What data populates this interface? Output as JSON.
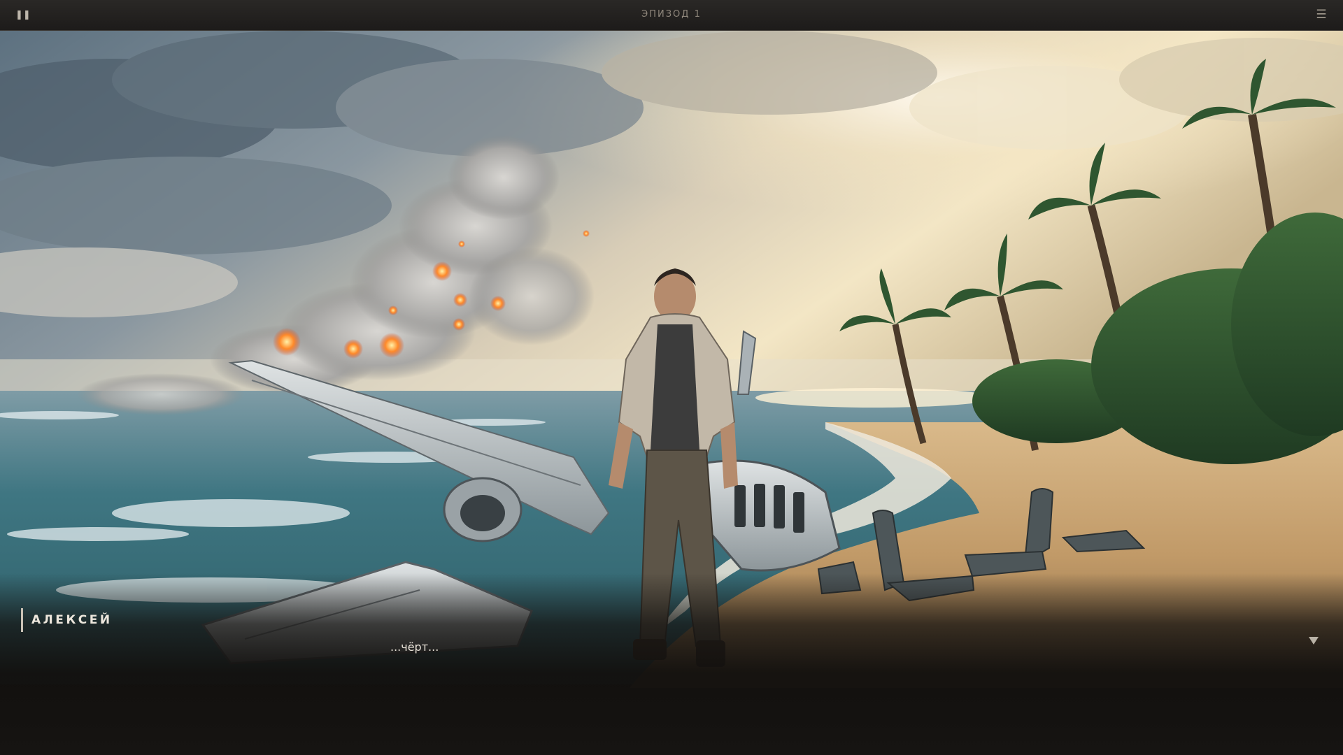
{
  "header": {
    "pause_icon": "pause-icon",
    "episode_title": "ЭПИЗОД 1",
    "menu_icon": "hamburger-menu-icon"
  },
  "scene": {
    "description_icon": "beach-plane-crash-scene"
  },
  "dialogue": {
    "speaker": "АЛЕКСЕЙ",
    "text": "...чёрт...",
    "advance_icon": "triangle-down-icon"
  },
  "colors": {
    "topbar": "#222020",
    "accent": "#c9c1b5",
    "text": "#e8e2d8"
  }
}
